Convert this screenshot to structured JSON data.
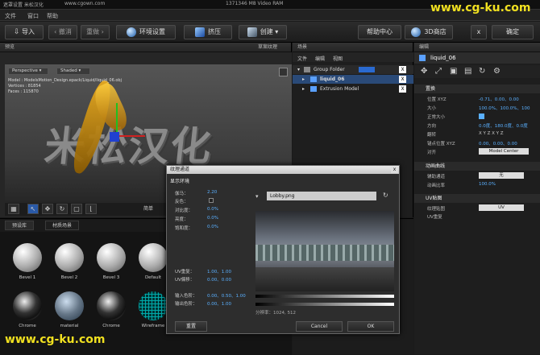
{
  "window": {
    "title": "遮罩设置 米松汉化",
    "url": "www.cgown.com",
    "center": "1371346 M8 Video RAM"
  },
  "menu": {
    "file": "文件",
    "window": "窗口",
    "help": "帮助"
  },
  "toolbar": {
    "import": "导入",
    "undo": "撤消",
    "redo": "重做",
    "env": "环境设置",
    "extrude": "挤压",
    "create": "创建",
    "help_center": "帮助中心",
    "store": "3D商店",
    "close": "x",
    "ok": "确定"
  },
  "viewport": {
    "header": "预览",
    "scene_tab": "草案纹理",
    "perspective": "Perspective",
    "shaded": "Shaded",
    "info_model": "Model :  ModelsMotion_Design.epack/Liquid/liquid_06.obj",
    "info_vertices": "Vertices :  81854",
    "info_faces": "Faces :  115870",
    "simple": "简单",
    "watermark_scene": "米松汉化"
  },
  "scene": {
    "header": "场景",
    "menu_file": "文件",
    "menu_edit": "编辑",
    "menu_view": "视图",
    "group": "Group Folder",
    "item1": "liquid_06",
    "item2": "Extrusion Model",
    "x": "X"
  },
  "props": {
    "header": "编辑",
    "object": "liquid_06",
    "sect_transform": "置换",
    "pos_lbl": "位置 XYZ",
    "pos_val": "-0.71、0.00、0.00",
    "size_lbl": "大小",
    "size_val": "100.0%、100.0%、100",
    "uniform_lbl": "正常大小",
    "dir_lbl": "方向",
    "dir_val": "0.0度、180.0度、0.0度",
    "flip_lbl": "翻转",
    "flip_val": "X   Y   Z   X   Y   Z",
    "anchor_lbl": "锚点位置 XYZ",
    "anchor_val": "0.00、0.00、0.00",
    "align_lbl": "对齐",
    "align_val": "Model Center",
    "sect_anim": "动画曲线",
    "assist_lbl": "辅助通道",
    "assist_val": "无",
    "anim_lbl": "动画比率",
    "anim_val": "100.0%",
    "sect_uv": "UV贴图",
    "tex_lbl": "纹理贴图",
    "tex_val": "UV",
    "uv_lbl": "UV重复"
  },
  "library": {
    "tab1": "预设库",
    "tab2": "材质场景",
    "row1": [
      "Bevel 1",
      "Bevel 2",
      "Bevel 3",
      "Default"
    ],
    "row2": [
      "Chrome",
      "material",
      "Chrome",
      "Wireframe"
    ]
  },
  "dialog": {
    "title": "纹理通道",
    "section": "显示环境",
    "gamma_lbl": "伽马：",
    "gamma_val": "2.20",
    "reflect_lbl": "反色：",
    "contrast_lbl": "对比度：",
    "contrast_val": "0.0%",
    "brightness_lbl": "亮度：",
    "brightness_val": "0.0%",
    "sat_lbl": "饱和度：",
    "sat_val": "0.0%",
    "file": "Lobby.png",
    "uvrep_lbl": "UV重复：",
    "uvrep_val": "1.00、1.00",
    "uvoff_lbl": "UV偏移：",
    "uvoff_val": "0.00、0.00",
    "in_lbl": "输入色阶：",
    "in_val": "0.00、0.50、1.00",
    "out_lbl": "输出色阶：",
    "out_val": "0.00、1.00",
    "res": "分辨率：1024, 512",
    "reset": "重置",
    "cancel": "Cancel",
    "ok": "OK"
  },
  "watermarks": {
    "top": "www.cg-ku.com",
    "bottom": "www.cg-ku.com"
  }
}
